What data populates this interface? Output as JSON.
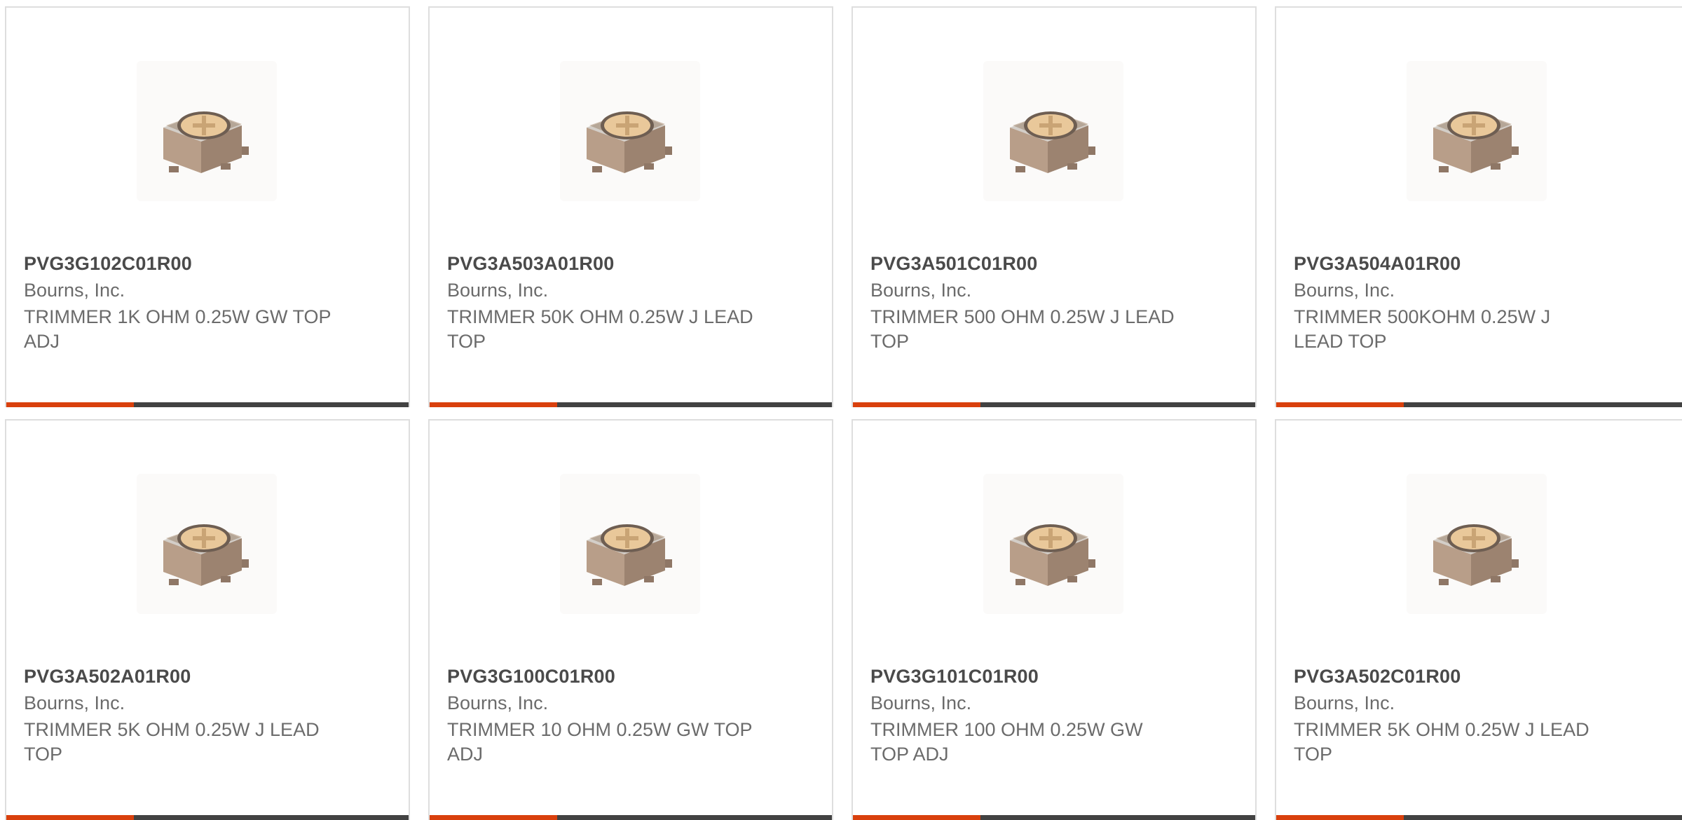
{
  "products": [
    {
      "part_number": "PVG3G102C01R00",
      "manufacturer": "Bourns, Inc.",
      "description": "TRIMMER 1K OHM 0.25W GW TOP ADJ",
      "image": "trimmer-potentiometer-photo"
    },
    {
      "part_number": "PVG3A503A01R00",
      "manufacturer": "Bourns, Inc.",
      "description": "TRIMMER 50K OHM 0.25W J LEAD TOP",
      "image": "trimmer-potentiometer-photo"
    },
    {
      "part_number": "PVG3A501C01R00",
      "manufacturer": "Bourns, Inc.",
      "description": "TRIMMER 500 OHM 0.25W J LEAD TOP",
      "image": "trimmer-potentiometer-photo"
    },
    {
      "part_number": "PVG3A504A01R00",
      "manufacturer": "Bourns, Inc.",
      "description": "TRIMMER 500KOHM 0.25W J LEAD TOP",
      "image": "trimmer-potentiometer-photo"
    },
    {
      "part_number": "PVG3A502A01R00",
      "manufacturer": "Bourns, Inc.",
      "description": "TRIMMER 5K OHM 0.25W J LEAD TOP",
      "image": "trimmer-potentiometer-photo"
    },
    {
      "part_number": "PVG3G100C01R00",
      "manufacturer": "Bourns, Inc.",
      "description": "TRIMMER 10 OHM 0.25W GW TOP ADJ",
      "image": "trimmer-potentiometer-photo"
    },
    {
      "part_number": "PVG3G101C01R00",
      "manufacturer": "Bourns, Inc.",
      "description": "TRIMMER 100 OHM 0.25W GW TOP ADJ",
      "image": "trimmer-potentiometer-photo"
    },
    {
      "part_number": "PVG3A502C01R00",
      "manufacturer": "Bourns, Inc.",
      "description": "TRIMMER 5K OHM 0.25W J LEAD TOP",
      "image": "trimmer-potentiometer-photo"
    }
  ],
  "colors": {
    "accent": "#d9400d",
    "bar": "#424242",
    "border": "#dedede",
    "text_title": "#4a4a4a",
    "text_body": "#6b6b6b"
  }
}
